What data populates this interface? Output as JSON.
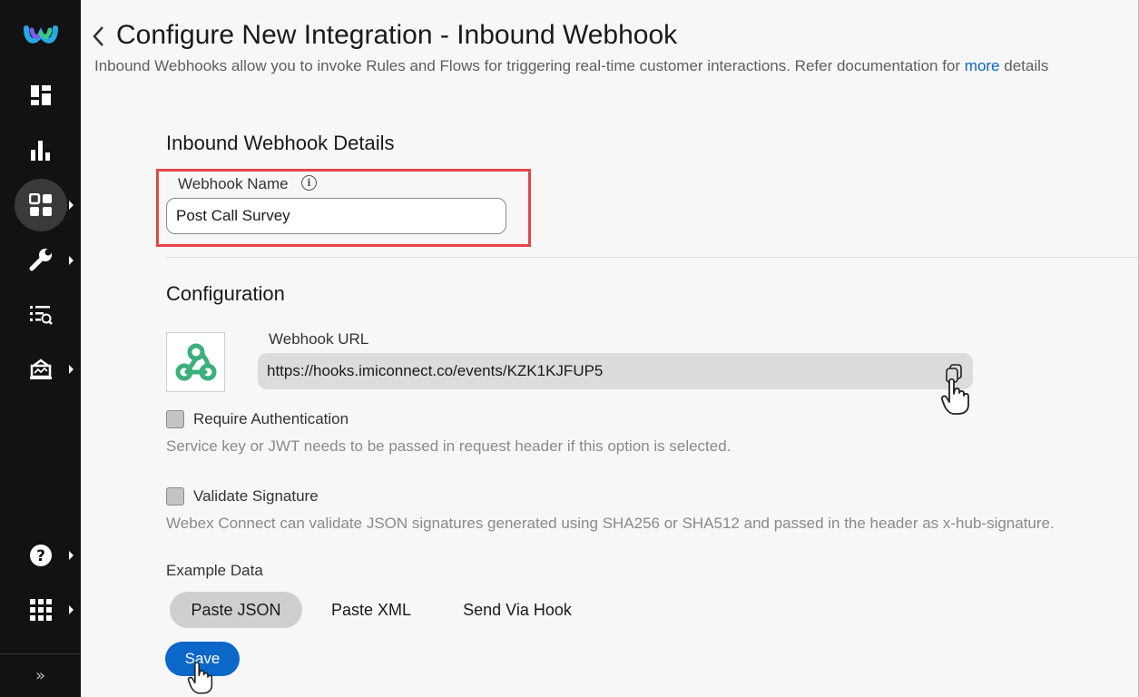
{
  "header": {
    "title": "Configure New Integration - Inbound Webhook",
    "description": "Inbound Webhooks allow you to invoke Rules and Flows for triggering real-time customer interactions. Refer documentation for ",
    "description_link": "more",
    "description_tail": " details"
  },
  "sidebar": {
    "items": [
      {
        "icon": "dashboard-icon"
      },
      {
        "icon": "analytics-icon"
      },
      {
        "icon": "apps-icon",
        "active": true
      },
      {
        "icon": "tools-icon"
      },
      {
        "icon": "logs-icon"
      },
      {
        "icon": "assets-icon"
      },
      {
        "icon": "help-icon"
      },
      {
        "icon": "grid-menu-icon"
      }
    ],
    "collapse_label": "»"
  },
  "details": {
    "section_title": "Inbound Webhook Details",
    "name_label": "Webhook Name",
    "name_value": "Post Call Survey"
  },
  "configuration": {
    "section_title": "Configuration",
    "url_label": "Webhook URL",
    "url_value": "https://hooks.imiconnect.co/events/KZK1KJFUP5",
    "require_auth_label": "Require Authentication",
    "require_auth_help": "Service key or JWT needs to be passed in request header if this option is selected.",
    "validate_sig_label": "Validate Signature",
    "validate_sig_help": "Webex Connect can validate JSON signatures generated using SHA256 or SHA512 and passed in the header as x-hub-signature."
  },
  "example_data": {
    "label": "Example Data",
    "tabs": [
      "Paste JSON",
      "Paste XML",
      "Send Via Hook"
    ],
    "active_tab": "Paste JSON"
  },
  "actions": {
    "save_label": "Save"
  },
  "colors": {
    "accent": "#0b67c8",
    "highlight": "#e6454c",
    "sidebar_bg": "#121212",
    "webhook_green": "#3bb07a"
  }
}
